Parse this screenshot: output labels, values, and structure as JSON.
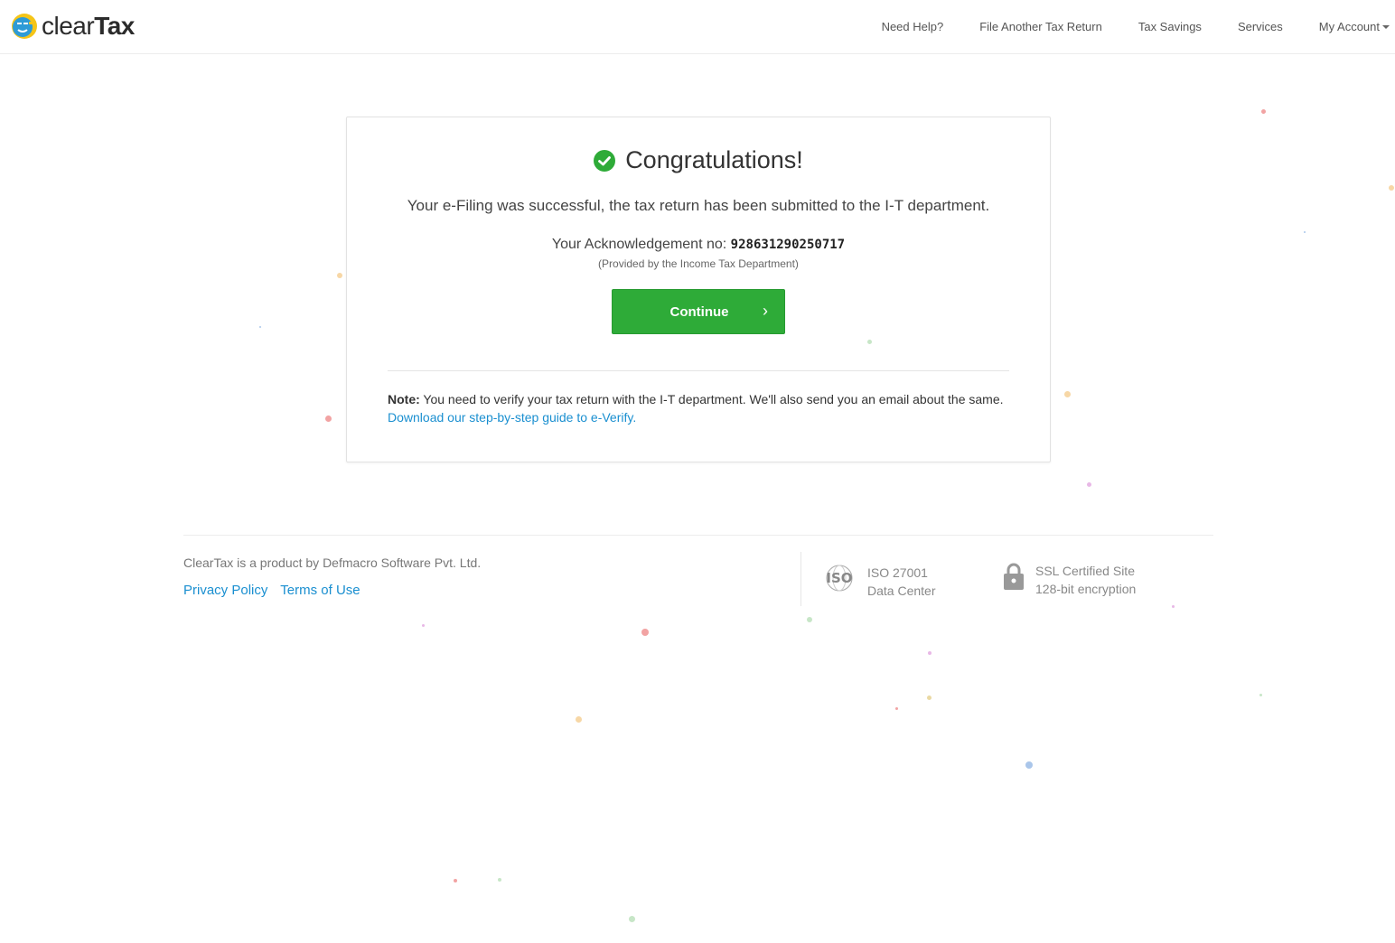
{
  "header": {
    "logo": {
      "text_light": "clear",
      "text_bold": "Tax"
    },
    "nav": [
      {
        "label": "Need Help?"
      },
      {
        "label": "File Another Tax Return"
      },
      {
        "label": "Tax Savings"
      },
      {
        "label": "Services"
      },
      {
        "label": "My Account"
      }
    ]
  },
  "card": {
    "title": "Congratulations!",
    "success_message": "Your e-Filing was successful, the tax return has been submitted to the I-T department.",
    "ack_label": "Your Acknowledgement no:",
    "ack_number": "928631290250717",
    "ack_provider": "(Provided by the Income Tax Department)",
    "continue_label": "Continue",
    "continue_icon": "chevron-right-icon",
    "note_label": "Note:",
    "note_text": "You need to verify your tax return with the I-T department. We'll also send you an email about the same.",
    "note_link": "Download our step-by-step guide to e-Verify."
  },
  "footer": {
    "company": "ClearTax is a product by Defmacro Software Pvt. Ltd.",
    "links": [
      {
        "label": "Privacy Policy"
      },
      {
        "label": "Terms of Use"
      }
    ],
    "iso": {
      "line1": "ISO 27001",
      "line2": "Data Center",
      "logo_text": "ISO"
    },
    "ssl": {
      "line1": "SSL Certified Site",
      "line2": "128-bit encryption"
    }
  },
  "colors": {
    "accent_green": "#2eab38",
    "link_blue": "#1a8fd0",
    "confetti": [
      "#f2a3a3",
      "#f7d7a6",
      "#c7e6c7",
      "#aac6ea",
      "#e8b8e6",
      "#ead9a3"
    ]
  }
}
